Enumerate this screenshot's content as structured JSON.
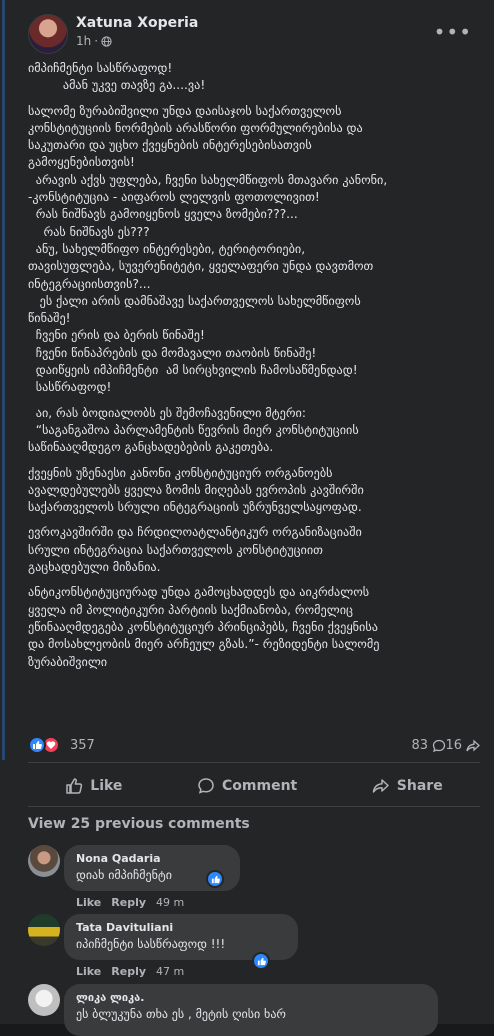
{
  "post": {
    "author": "Xatuna Xoperia",
    "time": "1h",
    "body": [
      "იმპიჩმენტი სასწრაფოდ!\n         ამან უკვე თავზე გა....ვა!",
      "სალომე ზურაბიშვილი უნდა დაისაჯოს საქართველოს\nკონსტიტუციის ნორმების არასწორი ფორმულირებისა და\nსაკუთარი და უცხო ქვეყნების ინტერესებისათვის\nგამოყენებისთვის!\n  არავის აქვს უფლება, ჩვენი სახელმწიფოს მთავარი კანონი,\n-კონსტიტუცია - აიფაროს ლელვის ფოთოლივით!\n  რას ნიშნავს გამოიყენოს ყველა ზომები???...\n    რას ნიშნავს ეს???\n  ანუ, სახელმწიფო ინტერესები, ტერიტორიები,\nთავისუფლება, სუვერენიტეტი, ყველაფერი უნდა დავთმოთ\nინტეგრაციისთვის?...\n   ეს ქალი არის დამნაშავე საქართველოს სახელმწიფოს\nწინაშე!\n  ჩვენი ერის და ბერის წინაშე!\n  ჩვენი წინაპრების და მომავალი თაობის წინაშე!\n  დაიწყეის იმპიჩმენტი  ამ სირცხვილის ჩამოსაწმენდად!\n  სასწრაფოდ!",
      "  აი, რას ბოდიალობს ეს შემოჩავენილი მტერი:\n  “საგანგაშოა პარლამენტის წევრის მიერ კონსტიტუციის\nსაწინააღმდეგო განცხადებების გაკეთება.",
      "ქვეყნის უზენაესი კანონი კონსტიტუციურ ორგანოებს\nავალდებულებს ყველა ზომის მიღებას ევროპის კავშირში\nსაქართველოს სრული ინტეგრაციის უზრუნველსაყოფად.",
      "ევროკავშირში და ჩრდილოატლანტიკურ ორგანიზაციაში\nსრული ინტეგრაცია საქართველოს კონსტიტუციით\nგაცხადებული მიზანია.",
      "ანტიკონსტიტუციურად უნდა გამოცხადდეს და აიკრძალოს\nყველა იმ პოლიტიკური პარტიის საქმიანობა, რომელიც\nეწინააღმდეგება კონსტიტუციურ პრინციპებს, ჩვენი ქვეყნისა\nდა მოსახლეობის მიერ არჩეულ გზას.”- რეზიდენტი სალომე\nზურაბიშვილი"
    ],
    "reaction_count": "357",
    "comment_count": "83",
    "share_count": "16"
  },
  "actions": {
    "like": "Like",
    "comment": "Comment",
    "share": "Share"
  },
  "comments_section": {
    "view_previous": "View 25 previous comments",
    "items": [
      {
        "name": "Nona Qadaria",
        "text": "დიახ იმპიჩმენტი",
        "like": "Like",
        "reply": "Reply",
        "time": "49 m"
      },
      {
        "name": "Tata Davituliani",
        "text": "იპიჩმენტი სასწრაფოდ !!!",
        "like": "Like",
        "reply": "Reply",
        "time": "47 m"
      },
      {
        "name": "ლიკა ლიკა.",
        "text": "ეს ბლუკუნა თხა ეს , მეტის ღისი ხარ"
      }
    ]
  },
  "colors": {
    "accent": "#2d88ff",
    "love": "#f33e58",
    "background": "#242526",
    "bubble": "#3a3b3c"
  },
  "icons": [
    "globe-icon",
    "more-icon",
    "like-reaction-icon",
    "love-reaction-icon",
    "comment-icon",
    "share-icon",
    "like-icon"
  ]
}
